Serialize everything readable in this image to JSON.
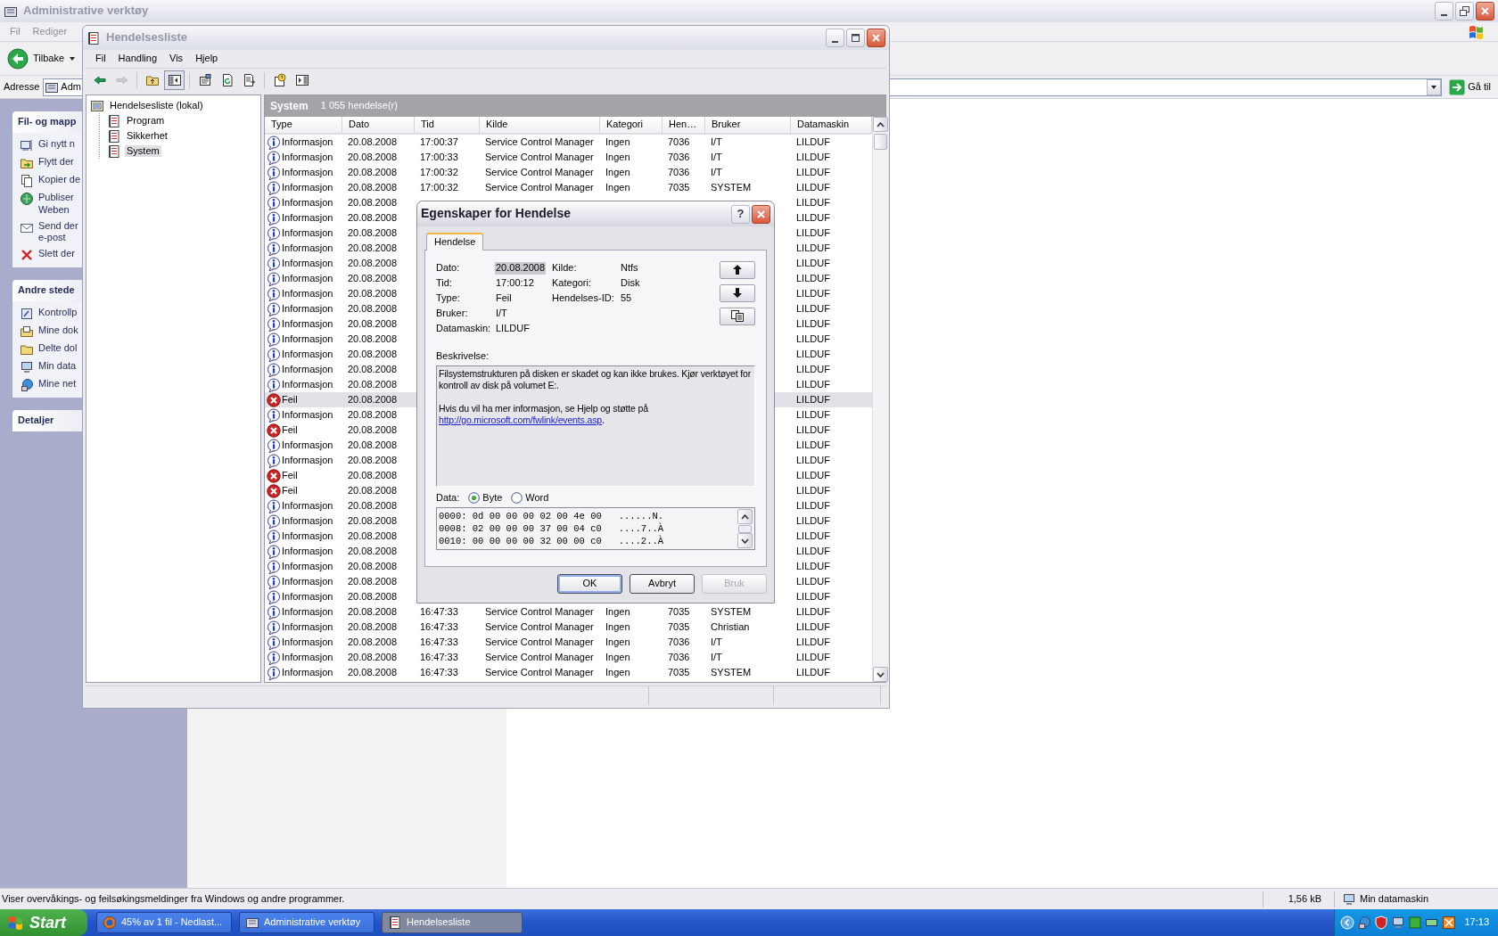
{
  "background_window": {
    "title": "Administrative verktøy",
    "menu": [
      "Fil",
      "Rediger"
    ],
    "back_button": "Tilbake",
    "address_label": "Adresse",
    "address_value": "Adm",
    "go_button": "Gå til",
    "task_panels": [
      {
        "title": "Fil- og mapp",
        "items": [
          {
            "kind": "rename",
            "lines": [
              "Gi nytt n"
            ]
          },
          {
            "kind": "move",
            "lines": [
              "Flytt der"
            ]
          },
          {
            "kind": "copy",
            "lines": [
              "Kopier de"
            ]
          },
          {
            "kind": "publish",
            "lines": [
              "Publiser",
              "Weben"
            ]
          },
          {
            "kind": "email",
            "lines": [
              "Send der",
              "e-post"
            ]
          },
          {
            "kind": "delete",
            "lines": [
              "Slett der"
            ]
          }
        ]
      },
      {
        "title": "Andre stede",
        "items": [
          {
            "kind": "control-panel",
            "lines": [
              "Kontrollp"
            ]
          },
          {
            "kind": "documents",
            "lines": [
              "Mine dok"
            ]
          },
          {
            "kind": "shared",
            "lines": [
              "Delte dol"
            ]
          },
          {
            "kind": "computer",
            "lines": [
              "Min data"
            ]
          },
          {
            "kind": "network",
            "lines": [
              "Mine net"
            ]
          }
        ]
      },
      {
        "title": "Detaljer"
      }
    ],
    "status_bar": [
      "Viser overvåkings- og feilsøkingsmeldinger fra Windows og andre programmer.",
      "1,56 kB",
      "Min datamaskin"
    ]
  },
  "event_viewer": {
    "title": "Hendelsesliste",
    "menu": [
      "Fil",
      "Handling",
      "Vis",
      "Hjelp"
    ],
    "toolbar": [
      {
        "kind": "back",
        "pressed": false,
        "disabled": false
      },
      {
        "kind": "forward",
        "pressed": false,
        "disabled": true
      },
      {
        "kind": "up",
        "pressed": false,
        "disabled": false
      },
      {
        "kind": "tree",
        "pressed": true,
        "disabled": false
      },
      {
        "kind": "properties",
        "pressed": false,
        "disabled": false
      },
      {
        "kind": "refresh",
        "pressed": false,
        "disabled": false
      },
      {
        "kind": "export",
        "pressed": false,
        "disabled": false
      },
      {
        "kind": "help",
        "pressed": false,
        "disabled": false
      },
      {
        "kind": "pane",
        "pressed": false,
        "disabled": false
      }
    ],
    "tree": [
      {
        "label": "Hendelsesliste (lokal)",
        "selected": false,
        "children": [
          {
            "label": "Program",
            "selected": false
          },
          {
            "label": "Sikkerhet",
            "selected": false
          },
          {
            "label": "System",
            "selected": true
          }
        ]
      }
    ],
    "list_header": {
      "title": "System",
      "count": "1 055 hendelse(r)"
    },
    "table": {
      "columns": [
        "Type",
        "Dato",
        "Tid",
        "Kilde",
        "Kategori",
        "Hen…",
        "Bruker",
        "Datamaskin"
      ],
      "rows": [
        {
          "kind": "info",
          "selected": false,
          "type": "Informasjon",
          "date": "20.08.2008",
          "time": "17:00:37",
          "source": "Service Control Manager",
          "category": "Ingen",
          "event_id": "7036",
          "user": "I/T",
          "computer": "LILDUF"
        },
        {
          "kind": "info",
          "selected": false,
          "type": "Informasjon",
          "date": "20.08.2008",
          "time": "17:00:33",
          "source": "Service Control Manager",
          "category": "Ingen",
          "event_id": "7036",
          "user": "I/T",
          "computer": "LILDUF"
        },
        {
          "kind": "info",
          "selected": false,
          "type": "Informasjon",
          "date": "20.08.2008",
          "time": "17:00:32",
          "source": "Service Control Manager",
          "category": "Ingen",
          "event_id": "7036",
          "user": "I/T",
          "computer": "LILDUF"
        },
        {
          "kind": "info",
          "selected": false,
          "type": "Informasjon",
          "date": "20.08.2008",
          "time": "17:00:32",
          "source": "Service Control Manager",
          "category": "Ingen",
          "event_id": "7035",
          "user": "SYSTEM",
          "computer": "LILDUF"
        },
        {
          "kind": "info",
          "selected": false,
          "type": "Informasjon",
          "date": "20.08.2008",
          "computer": "LILDUF"
        },
        {
          "kind": "info",
          "selected": false,
          "type": "Informasjon",
          "date": "20.08.2008",
          "computer": "LILDUF"
        },
        {
          "kind": "info",
          "selected": false,
          "type": "Informasjon",
          "date": "20.08.2008",
          "computer": "LILDUF"
        },
        {
          "kind": "info",
          "selected": false,
          "type": "Informasjon",
          "date": "20.08.2008",
          "computer": "LILDUF"
        },
        {
          "kind": "info",
          "selected": false,
          "type": "Informasjon",
          "date": "20.08.2008",
          "computer": "LILDUF"
        },
        {
          "kind": "info",
          "selected": false,
          "type": "Informasjon",
          "date": "20.08.2008",
          "computer": "LILDUF"
        },
        {
          "kind": "info",
          "selected": false,
          "type": "Informasjon",
          "date": "20.08.2008",
          "computer": "LILDUF"
        },
        {
          "kind": "info",
          "selected": false,
          "type": "Informasjon",
          "date": "20.08.2008",
          "computer": "LILDUF"
        },
        {
          "kind": "info",
          "selected": false,
          "type": "Informasjon",
          "date": "20.08.2008",
          "computer": "LILDUF"
        },
        {
          "kind": "info",
          "selected": false,
          "type": "Informasjon",
          "date": "20.08.2008",
          "computer": "LILDUF"
        },
        {
          "kind": "info",
          "selected": false,
          "type": "Informasjon",
          "date": "20.08.2008",
          "computer": "LILDUF"
        },
        {
          "kind": "info",
          "selected": false,
          "type": "Informasjon",
          "date": "20.08.2008",
          "computer": "LILDUF"
        },
        {
          "kind": "info",
          "selected": false,
          "type": "Informasjon",
          "date": "20.08.2008",
          "computer": "LILDUF"
        },
        {
          "kind": "error",
          "selected": true,
          "type": "Feil",
          "date": "20.08.2008",
          "computer": "LILDUF"
        },
        {
          "kind": "info",
          "selected": false,
          "type": "Informasjon",
          "date": "20.08.2008",
          "computer": "LILDUF"
        },
        {
          "kind": "error",
          "selected": false,
          "type": "Feil",
          "date": "20.08.2008",
          "computer": "LILDUF"
        },
        {
          "kind": "info",
          "selected": false,
          "type": "Informasjon",
          "date": "20.08.2008",
          "computer": "LILDUF"
        },
        {
          "kind": "info",
          "selected": false,
          "type": "Informasjon",
          "date": "20.08.2008",
          "computer": "LILDUF"
        },
        {
          "kind": "error",
          "selected": false,
          "type": "Feil",
          "date": "20.08.2008",
          "computer": "LILDUF"
        },
        {
          "kind": "error",
          "selected": false,
          "type": "Feil",
          "date": "20.08.2008",
          "computer": "LILDUF"
        },
        {
          "kind": "info",
          "selected": false,
          "type": "Informasjon",
          "date": "20.08.2008",
          "computer": "LILDUF"
        },
        {
          "kind": "info",
          "selected": false,
          "type": "Informasjon",
          "date": "20.08.2008",
          "computer": "LILDUF"
        },
        {
          "kind": "info",
          "selected": false,
          "type": "Informasjon",
          "date": "20.08.2008",
          "computer": "LILDUF"
        },
        {
          "kind": "info",
          "selected": false,
          "type": "Informasjon",
          "date": "20.08.2008",
          "computer": "LILDUF"
        },
        {
          "kind": "info",
          "selected": false,
          "type": "Informasjon",
          "date": "20.08.2008",
          "computer": "LILDUF"
        },
        {
          "kind": "info",
          "selected": false,
          "type": "Informasjon",
          "date": "20.08.2008",
          "computer": "LILDUF"
        },
        {
          "kind": "info",
          "selected": false,
          "type": "Informasjon",
          "date": "20.08.2008",
          "computer": "LILDUF"
        },
        {
          "kind": "info",
          "selected": false,
          "type": "Informasjon",
          "date": "20.08.2008",
          "time": "16:47:33",
          "source": "Service Control Manager",
          "category": "Ingen",
          "event_id": "7035",
          "user": "SYSTEM",
          "computer": "LILDUF"
        },
        {
          "kind": "info",
          "selected": false,
          "type": "Informasjon",
          "date": "20.08.2008",
          "time": "16:47:33",
          "source": "Service Control Manager",
          "category": "Ingen",
          "event_id": "7035",
          "user": "Christian",
          "computer": "LILDUF"
        },
        {
          "kind": "info",
          "selected": false,
          "type": "Informasjon",
          "date": "20.08.2008",
          "time": "16:47:33",
          "source": "Service Control Manager",
          "category": "Ingen",
          "event_id": "7036",
          "user": "I/T",
          "computer": "LILDUF"
        },
        {
          "kind": "info",
          "selected": false,
          "type": "Informasjon",
          "date": "20.08.2008",
          "time": "16:47:33",
          "source": "Service Control Manager",
          "category": "Ingen",
          "event_id": "7036",
          "user": "I/T",
          "computer": "LILDUF"
        },
        {
          "kind": "info",
          "selected": false,
          "type": "Informasjon",
          "date": "20.08.2008",
          "time": "16:47:33",
          "source": "Service Control Manager",
          "category": "Ingen",
          "event_id": "7035",
          "user": "SYSTEM",
          "computer": "LILDUF"
        }
      ]
    }
  },
  "dialog": {
    "title": "Egenskaper for Hendelse",
    "help_button": "?",
    "tabs": [
      {
        "label": "Hendelse",
        "selected": true
      }
    ],
    "left_fields": [
      {
        "label": "Dato:",
        "value": "20.08.2008",
        "selected": true
      },
      {
        "label": "Tid:",
        "value": "17:00:12",
        "selected": false
      },
      {
        "label": "Type:",
        "value": "Feil",
        "selected": false
      },
      {
        "label": "Bruker:",
        "value": "I/T",
        "selected": false
      },
      {
        "label": "Datamaskin:",
        "value": "LILDUF",
        "selected": false
      }
    ],
    "right_fields": [
      {
        "label": "Kilde:",
        "value": "Ntfs",
        "selected": false
      },
      {
        "label": "Kategori:",
        "value": "Disk",
        "selected": false
      },
      {
        "label": "Hendelses-ID:",
        "value": "55",
        "selected": false
      }
    ],
    "description_label": "Beskrivelse:",
    "description": {
      "text": "Filsystemstrukturen på disken er skadet og kan ikke brukes. Kjør verktøyet for kontroll av disk på volumet E:.",
      "more": "Hvis du vil ha mer informasjon, se Hjelp og støtte på",
      "link": "http://go.microsoft.com/fwlink/events.asp",
      "after": "."
    },
    "data_label": "Data:",
    "data_formats": [
      {
        "label": "Byte",
        "selected": true
      },
      {
        "label": "Word",
        "selected": false
      }
    ],
    "hex_lines": [
      "0000: 0d 00 00 00 02 00 4e 00   ......N.",
      "0008: 02 00 00 00 37 00 04 c0   ....7..À",
      "0010: 00 00 00 00 32 00 00 c0   ....2..À"
    ],
    "buttons": [
      {
        "label": "OK",
        "disabled": false
      },
      {
        "label": "Avbryt",
        "disabled": false
      },
      {
        "label": "Bruk",
        "disabled": true
      }
    ]
  },
  "taskbar": {
    "start": "Start",
    "buttons": [
      {
        "kind": "download",
        "label": "45% av 1 fil - Nedlast...",
        "selected": false
      },
      {
        "kind": "tools",
        "label": "Administrative verktøy",
        "selected": false
      },
      {
        "kind": "log",
        "label": "Hendelsesliste",
        "selected": true
      }
    ],
    "clock": "17:13"
  }
}
